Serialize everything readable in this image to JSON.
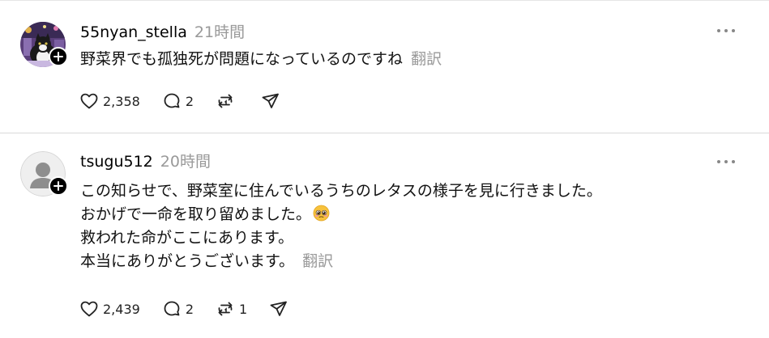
{
  "posts": [
    {
      "username": "55nyan_stella",
      "time": "21時間",
      "lines": [
        "野菜界でも孤独死が問題になっているのですね"
      ],
      "translate_label": "翻訳",
      "likes": "2,358",
      "replies": "2",
      "reposts": ""
    },
    {
      "username": "tsugu512",
      "time": "20時間",
      "lines": [
        "この知らせで、野菜室に住んでいるうちのレタスの様子を見に行きました。",
        "おかげで一命を取り留めました。",
        "救われた命がここにあります。",
        "本当にありがとうございます。"
      ],
      "emoji": "pleading-face-emoji",
      "translate_label": "翻訳",
      "likes": "2,439",
      "replies": "2",
      "reposts": "1"
    }
  ],
  "icons": {
    "like": "heart-icon",
    "reply": "comment-icon",
    "repost": "repost-icon",
    "share": "send-icon",
    "more": "more-icon",
    "follow": "plus-icon"
  }
}
